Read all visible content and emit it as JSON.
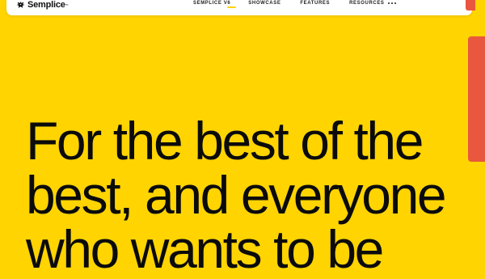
{
  "brand": {
    "name": "Semplice",
    "trademark": "™"
  },
  "nav": {
    "items": [
      {
        "label": "SEMPLICE V6"
      },
      {
        "label": "SHOWCASE"
      },
      {
        "label": "FEATURES"
      },
      {
        "label": "RESOURCES"
      }
    ],
    "more_icon": "more-horizontal-icon"
  },
  "hero": {
    "lines": [
      "For the best of the",
      "best, and everyone",
      "who wants to be"
    ]
  },
  "colors": {
    "background": "#ffd400",
    "accent": "#e9573f",
    "text": "#0b0b0b",
    "bar": "#ffffff"
  }
}
